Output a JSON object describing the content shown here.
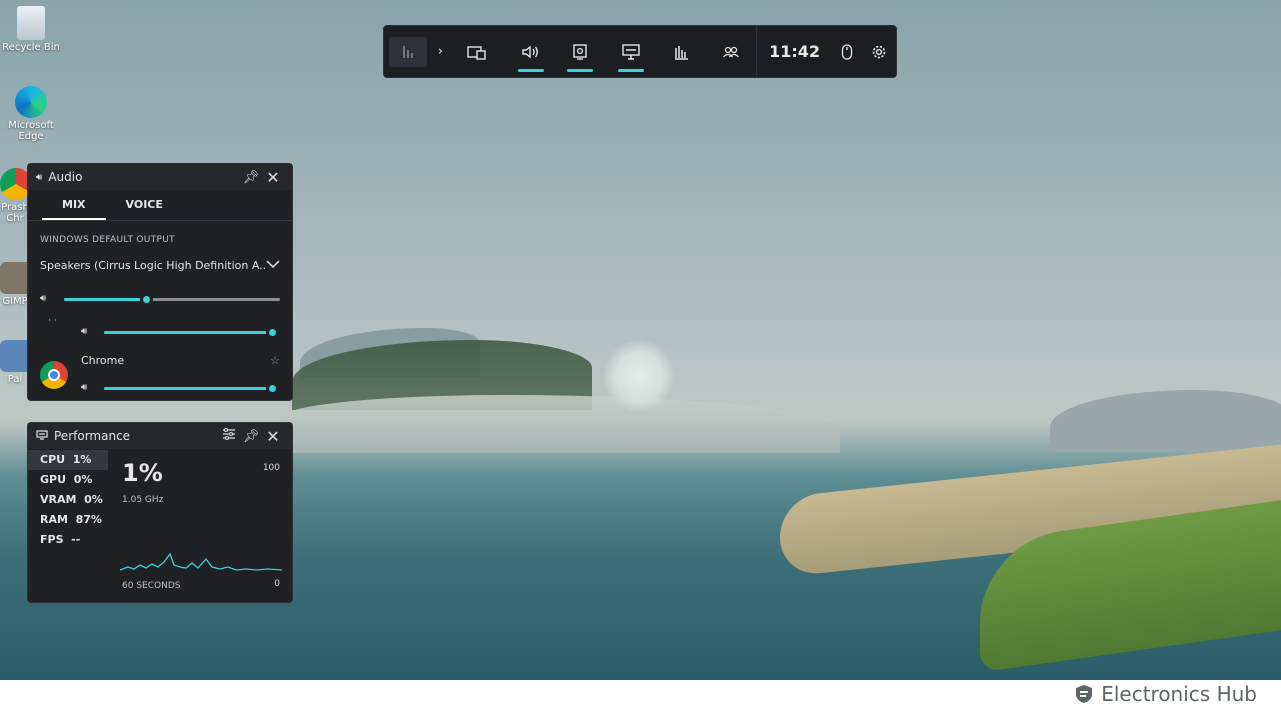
{
  "desktop": {
    "icons": [
      {
        "label": "Recycle Bin"
      },
      {
        "label": "Microsoft Edge"
      },
      {
        "label": "Prash Chr"
      },
      {
        "label": "GIMP"
      },
      {
        "label": "Pai"
      }
    ]
  },
  "gamebar": {
    "time": "11:42",
    "accent": "#3cd1d9"
  },
  "audio": {
    "title": "Audio",
    "tabs": [
      "MIX",
      "VOICE"
    ],
    "active_tab": "MIX",
    "section_label": "WINDOWS DEFAULT OUTPUT",
    "device": "Speakers (Cirrus Logic High Definition A...",
    "master_volume": 0.38,
    "app1_volume": 1.0,
    "app2": {
      "name": "Chrome",
      "volume": 1.0
    }
  },
  "performance": {
    "title": "Performance",
    "metrics": [
      {
        "label": "CPU",
        "value": "1%"
      },
      {
        "label": "GPU",
        "value": "0%"
      },
      {
        "label": "VRAM",
        "value": "0%"
      },
      {
        "label": "RAM",
        "value": "87%"
      },
      {
        "label": "FPS",
        "value": "--"
      }
    ],
    "big_value": "1%",
    "frequency": "1.05 GHz",
    "max_label": "100",
    "min_label": "0",
    "time_window": "60 SECONDS"
  },
  "footer": {
    "brand_electronics": "Electronics",
    "brand_hub": "Hub"
  }
}
